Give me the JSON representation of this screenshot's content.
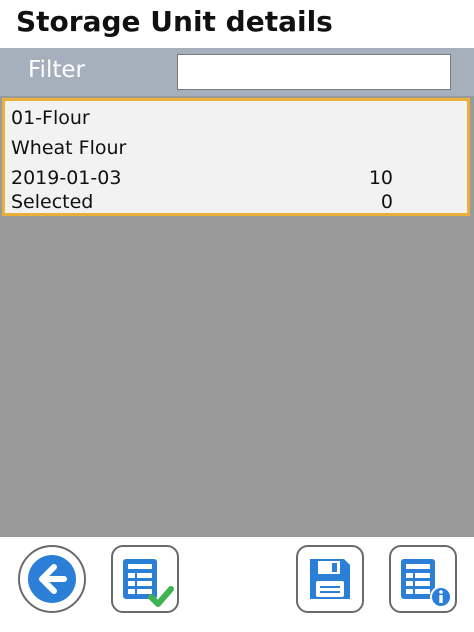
{
  "header": {
    "title": "Storage Unit details"
  },
  "filter": {
    "label": "Filter",
    "value": "",
    "placeholder": ""
  },
  "list": {
    "items": [
      {
        "code": "01-Flour",
        "name": "Wheat Flour",
        "date": "2019-01-03",
        "quantity": "10",
        "selected_label": "Selected",
        "selected_count": "0"
      }
    ]
  },
  "toolbar": {
    "buttons": [
      {
        "icon": "back-arrow-icon"
      },
      {
        "icon": "list-check-icon"
      },
      {
        "icon": "save-icon"
      },
      {
        "icon": "list-info-icon"
      }
    ]
  },
  "colors": {
    "filter_bar": "#a6b0bd",
    "list_background": "#9a9a9a",
    "selection_border": "#e9b13a",
    "icon_blue": "#2b7fd6",
    "check_green": "#3fb34f"
  }
}
